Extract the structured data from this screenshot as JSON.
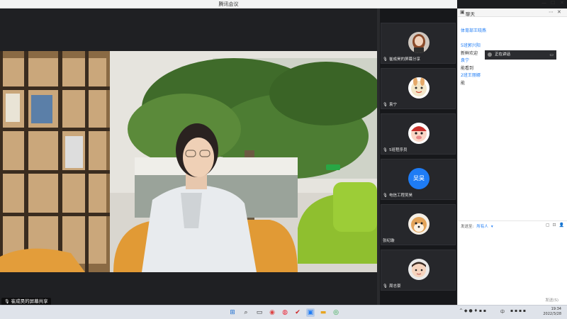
{
  "window": {
    "title": "腾讯会议"
  },
  "main_video": {
    "share_label": "崔成昊的屏幕共享",
    "green_tag": "说话中"
  },
  "participants": [
    {
      "name": "崔成昊的屏幕分享",
      "avatar": "woman-photo"
    },
    {
      "name": "袁宁",
      "avatar": "cartoon-rabbit"
    },
    {
      "name": "5班程序员",
      "avatar": "cartoon-pig"
    },
    {
      "name": "电信工程吴昊",
      "avatar_text": "吴昊"
    },
    {
      "name": "张纪璇",
      "avatar": "shiba-dog"
    },
    {
      "name": "周志豪",
      "avatar": "baby-photo"
    }
  ],
  "chat": {
    "title": "聊天",
    "messages": [
      {
        "text": "体育部王晓燕",
        "style": "blue"
      },
      {
        "text": "5班郭兴阳",
        "style": "blue"
      },
      {
        "text": "新鲜欢迎",
        "style": "dark"
      },
      {
        "text": "袁宁",
        "style": "blue"
      },
      {
        "text": "能看到",
        "style": "dark"
      },
      {
        "text": "2班王丽娜",
        "style": "blue"
      },
      {
        "text": "能",
        "style": "dark"
      }
    ],
    "tooltip": "正在讲话",
    "send_to_label": "发送至:",
    "send_to_value": "所有人",
    "send_button": "发送(S)"
  },
  "taskbar": {
    "tray_lang": "中",
    "clock_time": "19:34",
    "clock_date": "2022/3/28"
  },
  "colors": {
    "accent": "#1e7cf5",
    "stage_bg": "#1f2023",
    "taskbar_bg": "#dfe3ea"
  }
}
